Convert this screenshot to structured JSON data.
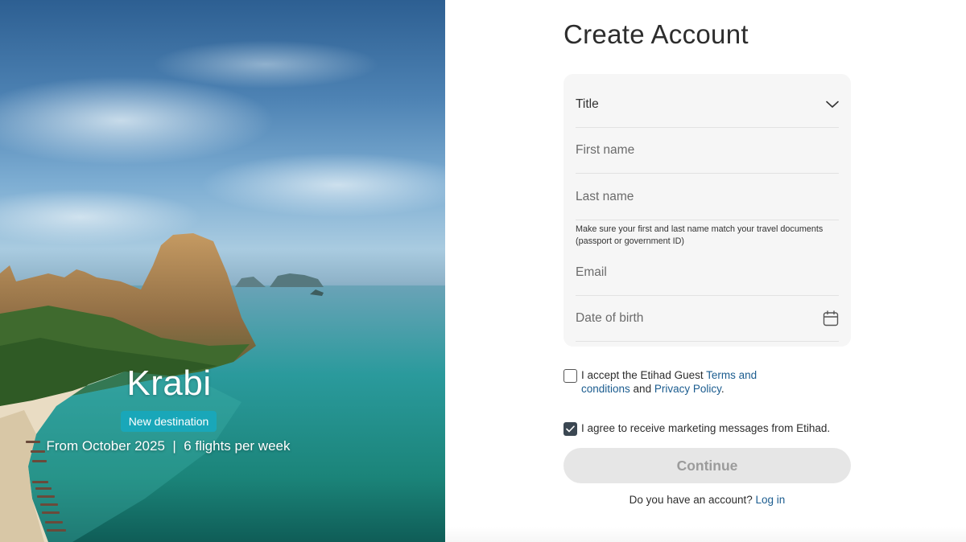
{
  "hero": {
    "destination": "Krabi",
    "badge": "New destination",
    "subtitle": "From October 2025  |  6 flights per week"
  },
  "form": {
    "heading": "Create Account",
    "title_label": "Title",
    "first_name_placeholder": "First name",
    "last_name_placeholder": "Last name",
    "name_hint": "Make sure your first and last name match your travel documents (passport or government ID)",
    "email_placeholder": "Email",
    "dob_placeholder": "Date of birth"
  },
  "consent": {
    "terms_prefix": "I accept the Etihad Guest ",
    "terms_link": "Terms and conditions",
    "terms_middle": " and ",
    "privacy_link": "Privacy Policy",
    "terms_suffix": ".",
    "terms_checked": false,
    "marketing_label": "I agree to receive marketing messages from Etihad.",
    "marketing_checked": true
  },
  "actions": {
    "continue_label": "Continue",
    "login_prompt": "Do you have an account? ",
    "login_link": "Log in"
  },
  "colors": {
    "link": "#1b5c8f",
    "badge": "#19a7b9",
    "checkbox_checked": "#3b4752",
    "button_disabled_bg": "#e6e6e6"
  },
  "icons": {
    "title_dropdown": "chevron-down-icon",
    "dob_picker": "calendar-icon",
    "marketing_checkbox": "checkmark-icon"
  }
}
